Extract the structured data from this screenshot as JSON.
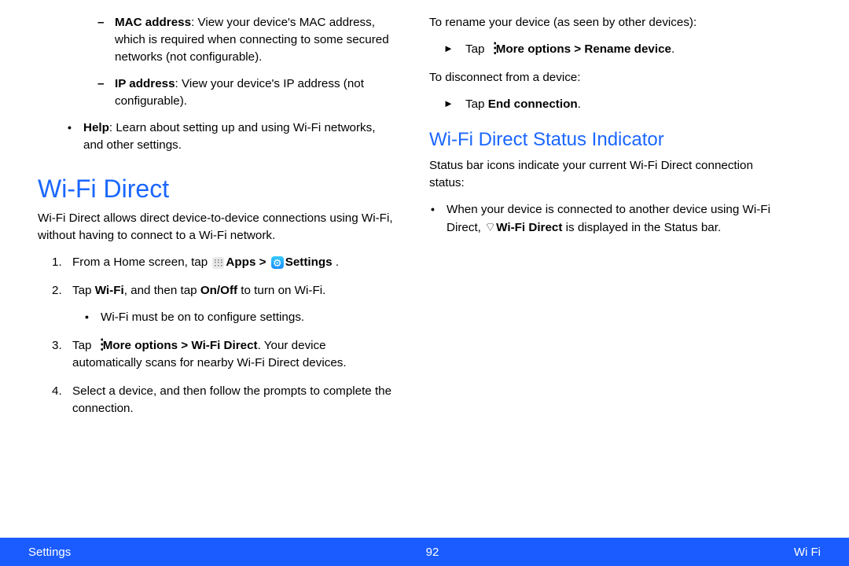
{
  "leftCol": {
    "dash1_label": "MAC address",
    "dash1_text": ": View your device's MAC address, which is required when connecting to some secured networks (not configurable).",
    "dash2_label": "IP address",
    "dash2_text": ": View your device's IP address (not configurable).",
    "help_label": "Help",
    "help_text": ": Learn about setting up and using Wi-Fi networks, and other settings.",
    "h1": "Wi-Fi Direct",
    "intro": "Wi-Fi Direct allows direct device-to-device connections using Wi-Fi, without having to connect to a Wi-Fi network.",
    "step1_a": "From a Home screen, tap ",
    "step1_apps": "Apps",
    "step1_gt": " > ",
    "step1_settings": "Settings",
    "step1_end": " .",
    "step2_a": "Tap ",
    "step2_wifi": "Wi-Fi",
    "step2_b": ", and then tap ",
    "step2_onoff": "On/Off",
    "step2_c": " to turn on Wi-Fi.",
    "step2_sub": "Wi-Fi must be on to configure settings.",
    "step3_a": "Tap ",
    "step3_more": "More options > Wi-Fi Direct",
    "step3_b": ". Your device automatically scans for nearby Wi-Fi Direct devices.",
    "step4": "Select a device, and then follow the prompts to complete the connection."
  },
  "rightCol": {
    "rename_intro": "To rename your device (as seen by other devices):",
    "rename_a": "Tap ",
    "rename_more": "More options > Rename device",
    "rename_end": ".",
    "disconnect_intro": "To disconnect from a device:",
    "disconnect_a": "Tap ",
    "disconnect_b": "End connection",
    "disconnect_end": ".",
    "h2": "Wi-Fi Direct Status Indicator",
    "status_intro": "Status bar icons indicate your current Wi-Fi Direct connection status:",
    "status_bullet_a": "When your device is connected to another device using Wi-Fi Direct, ",
    "status_bullet_b": "Wi-Fi Direct",
    "status_bullet_c": " is displayed in the Status bar."
  },
  "footer": {
    "left": "Settings",
    "center": "92",
    "right": "Wi Fi"
  }
}
